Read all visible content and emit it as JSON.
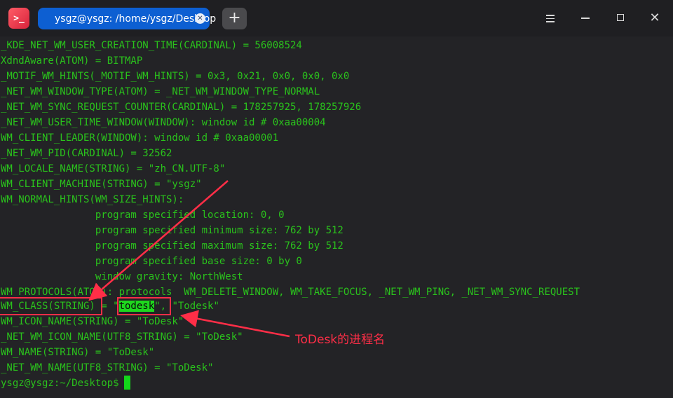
{
  "window": {
    "app_icon_glyph": ">_",
    "tab": {
      "title": "ysgz@ysgz: /home/ysgz/Desktop",
      "close_glyph": "✕"
    },
    "add_tab_glyph": "+",
    "controls": {
      "menu": "menu-icon",
      "minimize": "minimize-icon",
      "maximize": "maximize-icon",
      "close": "close-icon"
    },
    "close_glyph": "✕"
  },
  "terminal": {
    "colors": {
      "text": "#2ac21c",
      "background": "#232326",
      "highlight": "#1ed81e",
      "annotation": "#ff2e47"
    },
    "lines": [
      "_KDE_NET_WM_USER_CREATION_TIME(CARDINAL) = 56008524",
      "XdndAware(ATOM) = BITMAP",
      "_MOTIF_WM_HINTS(_MOTIF_WM_HINTS) = 0x3, 0x21, 0x0, 0x0, 0x0",
      "_NET_WM_WINDOW_TYPE(ATOM) = _NET_WM_WINDOW_TYPE_NORMAL",
      "_NET_WM_SYNC_REQUEST_COUNTER(CARDINAL) = 178257925, 178257926",
      "_NET_WM_USER_TIME_WINDOW(WINDOW): window id # 0xaa00004",
      "WM_CLIENT_LEADER(WINDOW): window id # 0xaa00001",
      "_NET_WM_PID(CARDINAL) = 32562",
      "WM_LOCALE_NAME(STRING) = \"zh_CN.UTF-8\"",
      "WM_CLIENT_MACHINE(STRING) = \"ysgz\"",
      "WM_NORMAL_HINTS(WM_SIZE_HINTS):",
      "                program specified location: 0, 0",
      "                program specified minimum size: 762 by 512",
      "                program specified maximum size: 762 by 512",
      "                program specified base size: 0 by 0",
      "                window gravity: NorthWest",
      "WM_PROTOCOLS(ATOM): protocols  WM_DELETE_WINDOW, WM_TAKE_FOCUS, _NET_WM_PING, _NET_WM_SYNC_REQUEST"
    ],
    "wm_class": {
      "prefix": "WM_CLASS(STRING) = \"",
      "highlight": "todesk",
      "suffix": "\", \"Todesk\""
    },
    "lines_after": [
      "WM_ICON_NAME(STRING) = \"ToDesk\"",
      "_NET_WM_ICON_NAME(UTF8_STRING) = \"ToDesk\"",
      "WM_NAME(STRING) = \"ToDesk\"",
      "_NET_WM_NAME(UTF8_STRING) = \"ToDesk\""
    ],
    "prompt": "ysgz@ysgz:~/Desktop$"
  },
  "annotation": {
    "label": "ToDesk的进程名"
  }
}
